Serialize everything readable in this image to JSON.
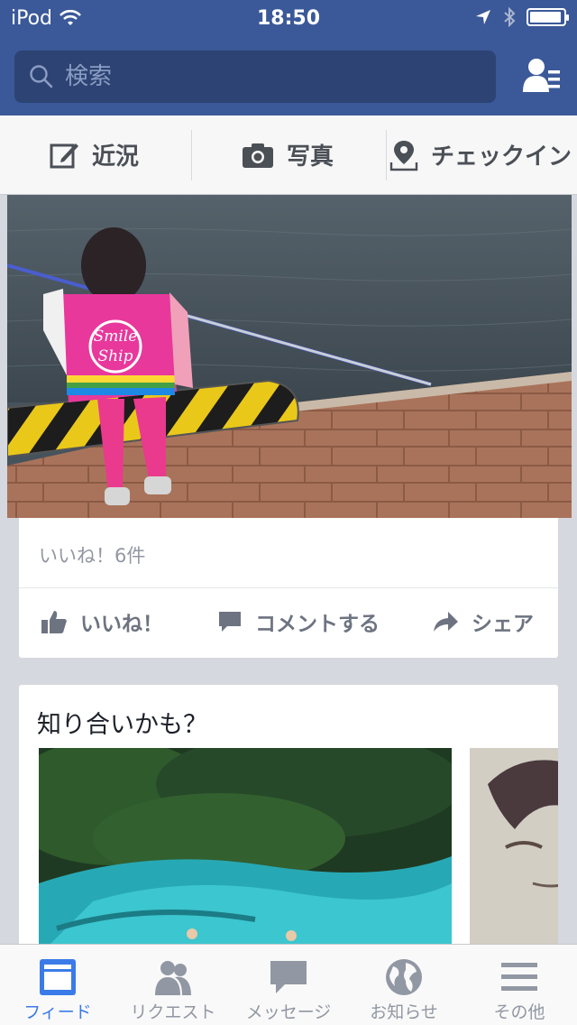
{
  "status_bar": {
    "carrier": "iPod",
    "time": "18:50",
    "battery_level": 0.95
  },
  "search": {
    "placeholder": "検索"
  },
  "composer": {
    "status_label": "近況",
    "photo_label": "写真",
    "checkin_label": "チェックイン"
  },
  "post": {
    "likes_count": "いいね！6件",
    "like_label": "いいね！",
    "comment_label": "コメントする",
    "share_label": "シェア",
    "vest_text_1": "Smile",
    "vest_text_2": "Ship"
  },
  "pymk": {
    "title": "知り合いかも？"
  },
  "tabs": [
    {
      "label": "フィード",
      "icon": "feed-icon",
      "active": true
    },
    {
      "label": "リクエスト",
      "icon": "friend-requests-icon"
    },
    {
      "label": "メッセージ",
      "icon": "messages-icon"
    },
    {
      "label": "お知らせ",
      "icon": "globe-icon"
    },
    {
      "label": "その他",
      "icon": "menu-icon"
    }
  ],
  "colors": {
    "brand": "#3b5998",
    "active_tab": "#3b7be8"
  }
}
